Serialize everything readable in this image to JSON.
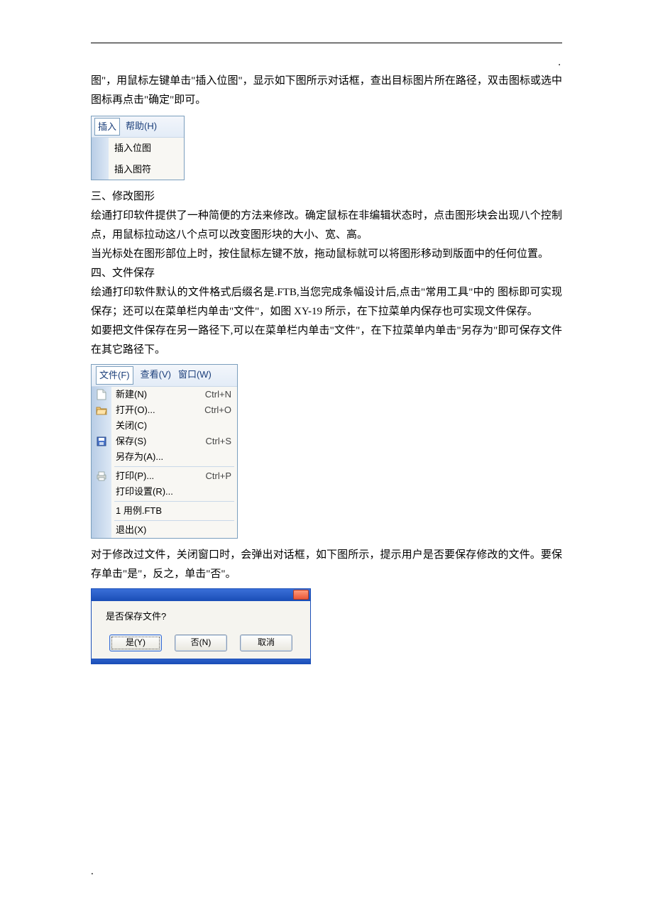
{
  "text": {
    "p1": "图\"，用鼠标左键单击\"插入位图\"，显示如下图所示对话框，查出目标图片所在路径，双击图标或选中图标再点击\"确定\"即可。",
    "h3": "三、修改图形",
    "p2": "绘通打印软件提供了一种简便的方法来修改。确定鼠标在非编辑状态时，点击图形块会出现八个控制点，用鼠标拉动这八个点可以改变图形块的大小、宽、高。",
    "p3": "当光标处在图形部位上时，按住鼠标左键不放，拖动鼠标就可以将图形移动到版面中的任何位置。",
    "h4": "四、文件保存",
    "p4": "绘通打印软件默认的文件格式后缀名是.FTB,当您完成条幅设计后,点击\"常用工具\"中的 图标即可实现保存；还可以在菜单栏内单击\"文件\"，如图 XY-19 所示，在下拉菜单内保存也可实现文件保存。",
    "p5": "如要把文件保存在另一路径下,可以在菜单栏内单击\"文件\"，在下拉菜单内单击\"另存为\"即可保存文件在其它路径下。",
    "p6": "对于修改过文件，关闭窗口时，会弹出对话框，如下图所示，提示用户是否要保存修改的文件。要保存单击\"是\"，反之，单击\"否\"。"
  },
  "insert_menu": {
    "title_insert": "插入",
    "title_help": "帮助(H)",
    "items": [
      "插入位图",
      "插入图符"
    ]
  },
  "file_menu": {
    "header": {
      "file": "文件(F)",
      "view": "查看(V)",
      "window": "窗口(W)"
    },
    "items": [
      {
        "icon": "new",
        "label": "新建(N)",
        "shortcut": "Ctrl+N"
      },
      {
        "icon": "open",
        "label": "打开(O)...",
        "shortcut": "Ctrl+O"
      },
      {
        "icon": "",
        "label": "关闭(C)",
        "shortcut": ""
      },
      {
        "icon": "save",
        "label": "保存(S)",
        "shortcut": "Ctrl+S"
      },
      {
        "icon": "",
        "label": "另存为(A)...",
        "shortcut": ""
      },
      {
        "sep": true
      },
      {
        "icon": "print",
        "label": "打印(P)...",
        "shortcut": "Ctrl+P"
      },
      {
        "icon": "",
        "label": "打印设置(R)...",
        "shortcut": ""
      },
      {
        "sep": true
      },
      {
        "icon": "",
        "label": "1 用例.FTB",
        "shortcut": ""
      },
      {
        "sep": true
      },
      {
        "icon": "",
        "label": "退出(X)",
        "shortcut": ""
      }
    ]
  },
  "save_dialog": {
    "message": "是否保存文件?",
    "buttons": {
      "yes": "是(Y)",
      "no": "否(N)",
      "cancel": "取消"
    }
  },
  "decor": {
    "dot": "."
  }
}
